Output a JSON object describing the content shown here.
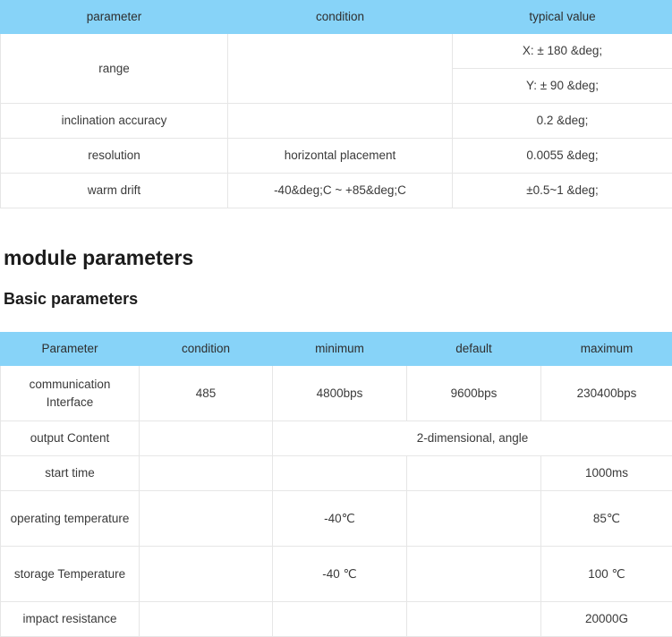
{
  "sensor_table": {
    "name": "sensor specification table",
    "headers": [
      "parameter",
      "condition",
      "typical value"
    ],
    "rows": [
      {
        "parameter": "range",
        "condition": "",
        "values": [
          "X: ± 180 &deg;",
          "Y: ± 90 &deg;"
        ]
      },
      {
        "parameter": "inclination accuracy",
        "condition": "",
        "values": [
          "0.2 &deg;"
        ]
      },
      {
        "parameter": "resolution",
        "condition": "horizontal placement",
        "values": [
          "0.0055 &deg;"
        ]
      },
      {
        "parameter": "warm drift",
        "condition": "-40&deg;C ~ +85&deg;C",
        "values": [
          "±0.5~1 &deg;"
        ]
      }
    ]
  },
  "headings": {
    "module_parameters": "module parameters",
    "basic_parameters": "Basic parameters"
  },
  "module_table": {
    "name": "module basic parameters table",
    "headers": [
      "Parameter",
      "condition",
      "minimum",
      "default",
      "maximum"
    ],
    "rows": [
      {
        "parameter": "communication Interface",
        "condition": "485",
        "minimum": "4800bps",
        "default": "9600bps",
        "maximum": "230400bps",
        "merged": false
      },
      {
        "parameter": "output Content",
        "condition": "",
        "merged_value": "2-dimensional, angle",
        "merged": true
      },
      {
        "parameter": "start time",
        "condition": "",
        "minimum": "",
        "default": "",
        "maximum": "1000ms",
        "merged": false
      },
      {
        "parameter": "operating temperature",
        "condition": "",
        "minimum": "-40℃",
        "default": "",
        "maximum": "85℃",
        "merged": false
      },
      {
        "parameter": "storage Temperature",
        "condition": "",
        "minimum": "-40 ℃",
        "default": "",
        "maximum": "100 ℃",
        "merged": false
      },
      {
        "parameter": "impact resistance",
        "condition": "",
        "minimum": "",
        "default": "",
        "maximum": "20000G",
        "merged": false
      }
    ]
  },
  "colors": {
    "header_blue": "#87d3f8",
    "border_grey": "#e6e6e6",
    "text": "#3a3a3a",
    "heading_text": "#1b1b1b",
    "page_background": "#ffffff"
  }
}
